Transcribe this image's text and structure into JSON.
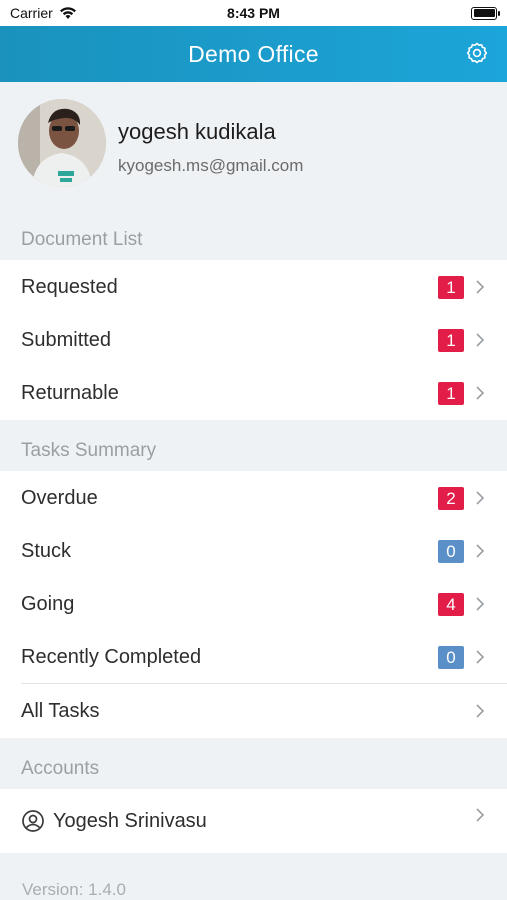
{
  "status_bar": {
    "carrier": "Carrier",
    "time": "8:43 PM"
  },
  "nav": {
    "title": "Demo Office"
  },
  "profile": {
    "name": "yogesh kudikala",
    "email": "kyogesh.ms@gmail.com"
  },
  "document_list": {
    "header": "Document List",
    "items": [
      {
        "label": "Requested",
        "badge": "1"
      },
      {
        "label": "Submitted",
        "badge": "1"
      },
      {
        "label": "Returnable",
        "badge": "1"
      }
    ]
  },
  "tasks_summary": {
    "header": "Tasks Summary",
    "items": [
      {
        "label": "Overdue",
        "badge": "2"
      },
      {
        "label": "Stuck",
        "badge": "0"
      },
      {
        "label": "Going",
        "badge": "4"
      },
      {
        "label": "Recently Completed",
        "badge": "0"
      },
      {
        "label": "All Tasks"
      }
    ]
  },
  "accounts": {
    "header": "Accounts",
    "items": [
      {
        "label": "Yogesh Srinivasu"
      }
    ]
  },
  "footer": {
    "version": "Version: 1.4.0"
  },
  "colors": {
    "accent": "#1ca5d9",
    "badge_red": "#e11d48",
    "badge_blue": "#5b8fc7"
  }
}
